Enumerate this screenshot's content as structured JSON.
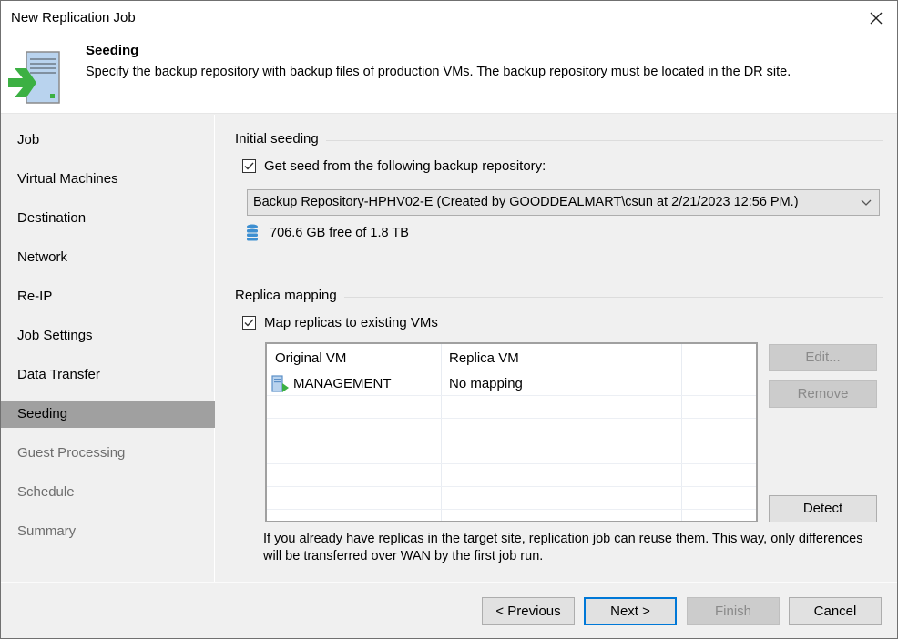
{
  "window": {
    "title": "New Replication Job"
  },
  "header": {
    "title": "Seeding",
    "description": "Specify the backup repository with backup files of production VMs. The backup repository must be located in the DR site.",
    "icon": "replication-job-icon"
  },
  "sidebar": {
    "items": [
      {
        "label": "Job",
        "state": "normal"
      },
      {
        "label": "Virtual Machines",
        "state": "normal"
      },
      {
        "label": "Destination",
        "state": "normal"
      },
      {
        "label": "Network",
        "state": "normal"
      },
      {
        "label": "Re-IP",
        "state": "normal"
      },
      {
        "label": "Job Settings",
        "state": "normal"
      },
      {
        "label": "Data Transfer",
        "state": "normal"
      },
      {
        "label": "Seeding",
        "state": "active"
      },
      {
        "label": "Guest Processing",
        "state": "disabled"
      },
      {
        "label": "Schedule",
        "state": "disabled"
      },
      {
        "label": "Summary",
        "state": "disabled"
      }
    ]
  },
  "initial_seeding": {
    "group_label": "Initial seeding",
    "checkbox_label": "Get seed from the following backup repository:",
    "checked": true,
    "repository_selected": "Backup Repository-HPHV02-E (Created by GOODDEALMART\\csun at 2/21/2023 12:56 PM.)",
    "storage_icon": "database-icon",
    "storage_text": "706.6 GB free of 1.8 TB"
  },
  "replica_mapping": {
    "group_label": "Replica mapping",
    "checkbox_label": "Map replicas to existing VMs",
    "checked": true,
    "columns": [
      "Original VM",
      "Replica VM",
      ""
    ],
    "rows": [
      {
        "original_vm": "MANAGEMENT",
        "replica_vm": "No mapping",
        "icon": "vm-icon"
      }
    ],
    "buttons": {
      "edit": "Edit...",
      "remove": "Remove",
      "detect": "Detect"
    },
    "hint": "If you already have replicas in the target site, replication job can reuse them. This way, only differences will be transferred over WAN by the first job run."
  },
  "footer": {
    "previous": "< Previous",
    "next": "Next >",
    "finish": "Finish",
    "cancel": "Cancel"
  },
  "colors": {
    "accent_focus": "#0078d7",
    "active_nav_bg": "#a0a0a0",
    "arrow_green": "#3cb043",
    "server_blue": "#b9d3ee"
  }
}
